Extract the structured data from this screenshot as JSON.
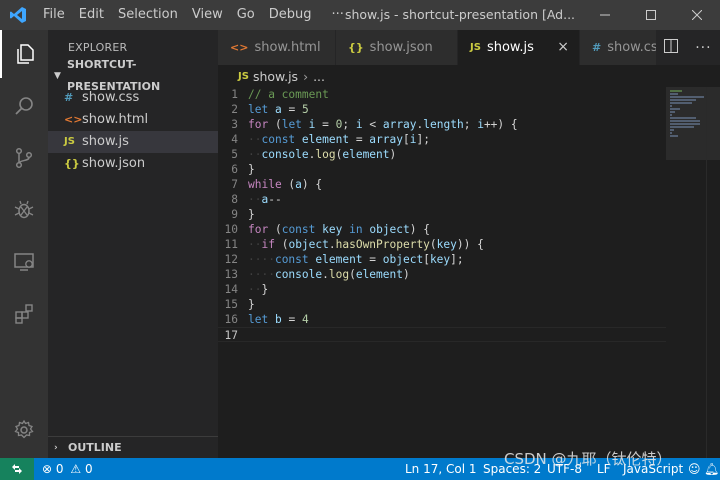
{
  "titlebar": {
    "menu": [
      "File",
      "Edit",
      "Selection",
      "View",
      "Go",
      "Debug",
      "···"
    ],
    "window_title": "show.js - shortcut-presentation [Ad..."
  },
  "sidebar": {
    "header": "EXPLORER",
    "folder": "SHORTCUT-PRESENTATION",
    "files": [
      {
        "icon": "#",
        "name": "show.css",
        "icon_color": "#519aba"
      },
      {
        "icon": "<>",
        "name": "show.html",
        "icon_color": "#e37933"
      },
      {
        "icon": "JS",
        "name": "show.js",
        "icon_color": "#cbcb41"
      },
      {
        "icon": "{}",
        "name": "show.json",
        "icon_color": "#cbcb41"
      }
    ],
    "outline": "OUTLINE"
  },
  "tabs": [
    {
      "icon": "<>",
      "label": "show.html",
      "icon_color": "#e37933"
    },
    {
      "icon": "{}",
      "label": "show.json",
      "icon_color": "#cbcb41"
    },
    {
      "icon": "JS",
      "label": "show.js",
      "icon_color": "#cbcb41",
      "close": "×"
    },
    {
      "icon": "#",
      "label": "show.css",
      "icon_color": "#519aba"
    }
  ],
  "breadcrumb": {
    "icon": "JS",
    "file": "show.js",
    "sep": "›",
    "more": "..."
  },
  "editor": {
    "line_numbers": [
      "1",
      "2",
      "3",
      "4",
      "5",
      "6",
      "7",
      "8",
      "9",
      "10",
      "11",
      "12",
      "13",
      "14",
      "15",
      "16",
      "17"
    ]
  },
  "statusbar": {
    "errors": "0",
    "warnings": "0",
    "position": "Ln 17, Col 1",
    "spaces": "Spaces: 2",
    "encoding": "UTF-8",
    "eol": "LF",
    "language": "JavaScript"
  },
  "watermark": "CSDN @九耶（钛伦特）"
}
